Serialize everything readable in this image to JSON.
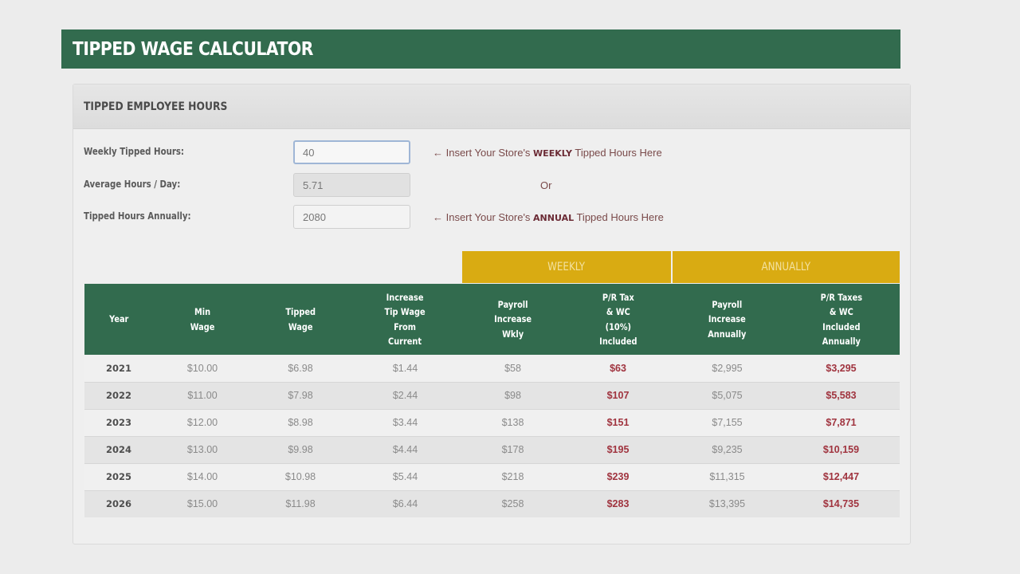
{
  "banner": {
    "title": "TIPPED WAGE CALCULATOR"
  },
  "panel": {
    "title": "TIPPED EMPLOYEE HOURS",
    "fields": [
      {
        "label": "Weekly Tipped Hours:",
        "value": "40",
        "hint_prefix": "← Insert Your Store's ",
        "hint_bold": "WEEKLY",
        "hint_suffix": " Tipped Hours Here"
      },
      {
        "label": "Average Hours / Day:",
        "value": "5.71",
        "or_text": "Or"
      },
      {
        "label": "Tipped Hours Annually:",
        "value": "2080",
        "hint_prefix": "← Insert Your Store's ",
        "hint_bold": "ANNUAL",
        "hint_suffix": " Tipped Hours Here"
      }
    ]
  },
  "group_headers": {
    "weekly": "WEEKLY",
    "annually": "ANNUALLY"
  },
  "colors": {
    "brand_green": "#326b4e",
    "accent_yellow": "#d9ab12",
    "emphasis_red": "#a0343f"
  },
  "table": {
    "headers": [
      "Year",
      "Min\nWage",
      "Tipped\nWage",
      "Increase\nTip Wage\nFrom\nCurrent",
      "Payroll\nIncrease\nWkly",
      "P/R Tax\n& WC\n(10%)\nIncluded",
      "Payroll\nIncrease\nAnnually",
      "P/R Taxes\n& WC\nIncluded\nAnnually"
    ],
    "rows": [
      [
        "2021",
        "$10.00",
        "$6.98",
        "$1.44",
        "$58",
        "$63",
        "$2,995",
        "$3,295"
      ],
      [
        "2022",
        "$11.00",
        "$7.98",
        "$2.44",
        "$98",
        "$107",
        "$5,075",
        "$5,583"
      ],
      [
        "2023",
        "$12.00",
        "$8.98",
        "$3.44",
        "$138",
        "$151",
        "$7,155",
        "$7,871"
      ],
      [
        "2024",
        "$13.00",
        "$9.98",
        "$4.44",
        "$178",
        "$195",
        "$9,235",
        "$10,159"
      ],
      [
        "2025",
        "$14.00",
        "$10.98",
        "$5.44",
        "$218",
        "$239",
        "$11,315",
        "$12,447"
      ],
      [
        "2026",
        "$15.00",
        "$11.98",
        "$6.44",
        "$258",
        "$283",
        "$13,395",
        "$14,735"
      ]
    ]
  }
}
